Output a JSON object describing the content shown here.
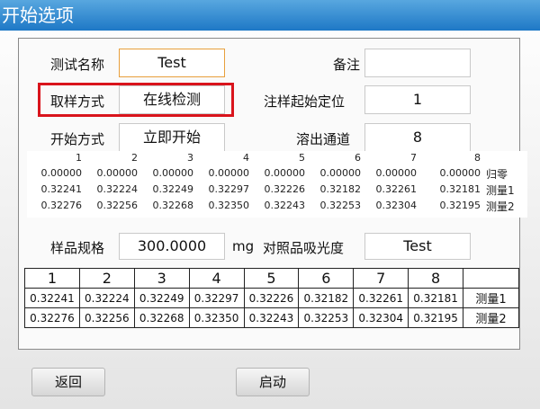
{
  "window": {
    "title": "开始选项"
  },
  "form": {
    "test_name_label": "测试名称",
    "test_name_value": "Test",
    "remark_label": "备注",
    "remark_value": "",
    "sampling_label": "取样方式",
    "sampling_value": "在线检测",
    "injection_start_label": "注样起始定位",
    "injection_start_value": "1",
    "start_mode_label": "开始方式",
    "start_mode_value": "立即开始",
    "dissolution_channel_label": "溶出通道",
    "dissolution_channel_value": "8",
    "sample_spec_label": "样品规格",
    "sample_spec_value": "300.0000",
    "sample_spec_unit": "mg",
    "ref_absorbance_label": "对照品吸光度",
    "ref_absorbance_value": "Test"
  },
  "mini_table": {
    "headers": [
      "1",
      "2",
      "3",
      "4",
      "5",
      "6",
      "7",
      "8"
    ],
    "rows": [
      {
        "label": "归零",
        "values": [
          "0.00000",
          "0.00000",
          "0.00000",
          "0.00000",
          "0.00000",
          "0.00000",
          "0.00000",
          "0.00000"
        ]
      },
      {
        "label": "测量1",
        "values": [
          "0.32241",
          "0.32224",
          "0.32249",
          "0.32297",
          "0.32226",
          "0.32182",
          "0.32261",
          "0.32181"
        ]
      },
      {
        "label": "测量2",
        "values": [
          "0.32276",
          "0.32256",
          "0.32268",
          "0.32350",
          "0.32243",
          "0.32253",
          "0.32304",
          "0.32195"
        ]
      }
    ]
  },
  "results_table": {
    "headers": [
      "1",
      "2",
      "3",
      "4",
      "5",
      "6",
      "7",
      "8",
      ""
    ],
    "rows": [
      {
        "label": "测量1",
        "values": [
          "0.32241",
          "0.32224",
          "0.32249",
          "0.32297",
          "0.32226",
          "0.32182",
          "0.32261",
          "0.32181"
        ]
      },
      {
        "label": "测量2",
        "values": [
          "0.32276",
          "0.32256",
          "0.32268",
          "0.32350",
          "0.32243",
          "0.32253",
          "0.32304",
          "0.32195"
        ]
      }
    ]
  },
  "buttons": {
    "back": "返回",
    "start": "启动"
  },
  "colors": {
    "titlebar": "#2a86d3",
    "highlight": "#d9141c",
    "field_focus": "#e89f3c"
  }
}
